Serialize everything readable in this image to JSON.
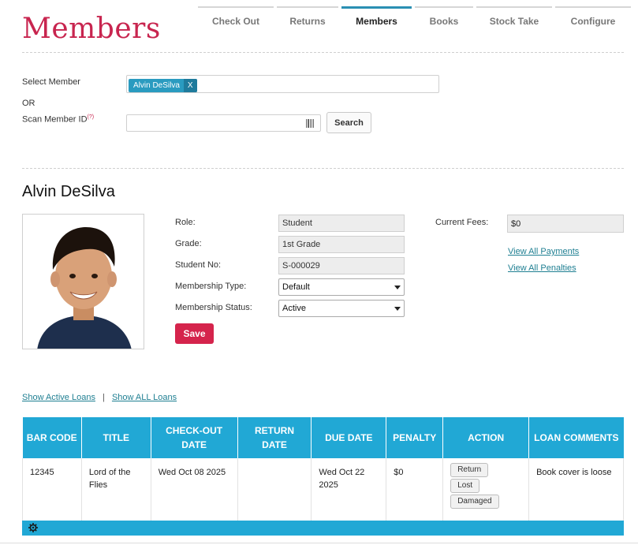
{
  "page": {
    "title": "Members"
  },
  "tabs": [
    {
      "label": "Check Out"
    },
    {
      "label": "Returns"
    },
    {
      "label": "Members",
      "active": true
    },
    {
      "label": "Books"
    },
    {
      "label": "Stock Take"
    },
    {
      "label": "Configure"
    }
  ],
  "select_member": {
    "label": "Select Member",
    "chip_name": "Alvin DeSilva",
    "chip_remove": "X",
    "or_label": "OR",
    "scan_label": "Scan Member ID",
    "scan_hint": "(?)",
    "scan_value": "",
    "search_label": "Search"
  },
  "member": {
    "name": "Alvin DeSilva",
    "role_label": "Role:",
    "role": "Student",
    "grade_label": "Grade:",
    "grade": "1st Grade",
    "student_no_label": "Student No:",
    "student_no": "S-000029",
    "membership_type_label": "Membership Type:",
    "membership_type": "Default",
    "membership_status_label": "Membership Status:",
    "membership_status": "Active",
    "save_label": "Save",
    "fees_label": "Current Fees:",
    "fees": "$0",
    "view_payments": "View All Payments",
    "view_penalties": "View All Penalties"
  },
  "loans": {
    "show_active": "Show Active Loans",
    "separator": "|",
    "show_all": "Show ALL Loans",
    "columns": [
      "BAR CODE",
      "TITLE",
      "CHECK-OUT DATE",
      "RETURN DATE",
      "DUE DATE",
      "PENALTY",
      "ACTION",
      "LOAN COMMENTS"
    ],
    "rows": [
      {
        "barcode": "12345",
        "title": "Lord of the Flies",
        "checkout": "Wed Oct 08 2025",
        "return": "",
        "due": "Wed Oct 22 2025",
        "penalty": "$0",
        "actions": [
          "Return",
          "Lost",
          "Damaged"
        ],
        "comments": "Book cover is loose"
      }
    ]
  },
  "colors": {
    "brand": "#c8254f",
    "accent": "#21a8d5",
    "link": "#1f7f92",
    "save": "#d5244c"
  },
  "icons": {
    "barcode": "barcode-icon",
    "gear": "gear-icon",
    "remove": "close-icon"
  }
}
